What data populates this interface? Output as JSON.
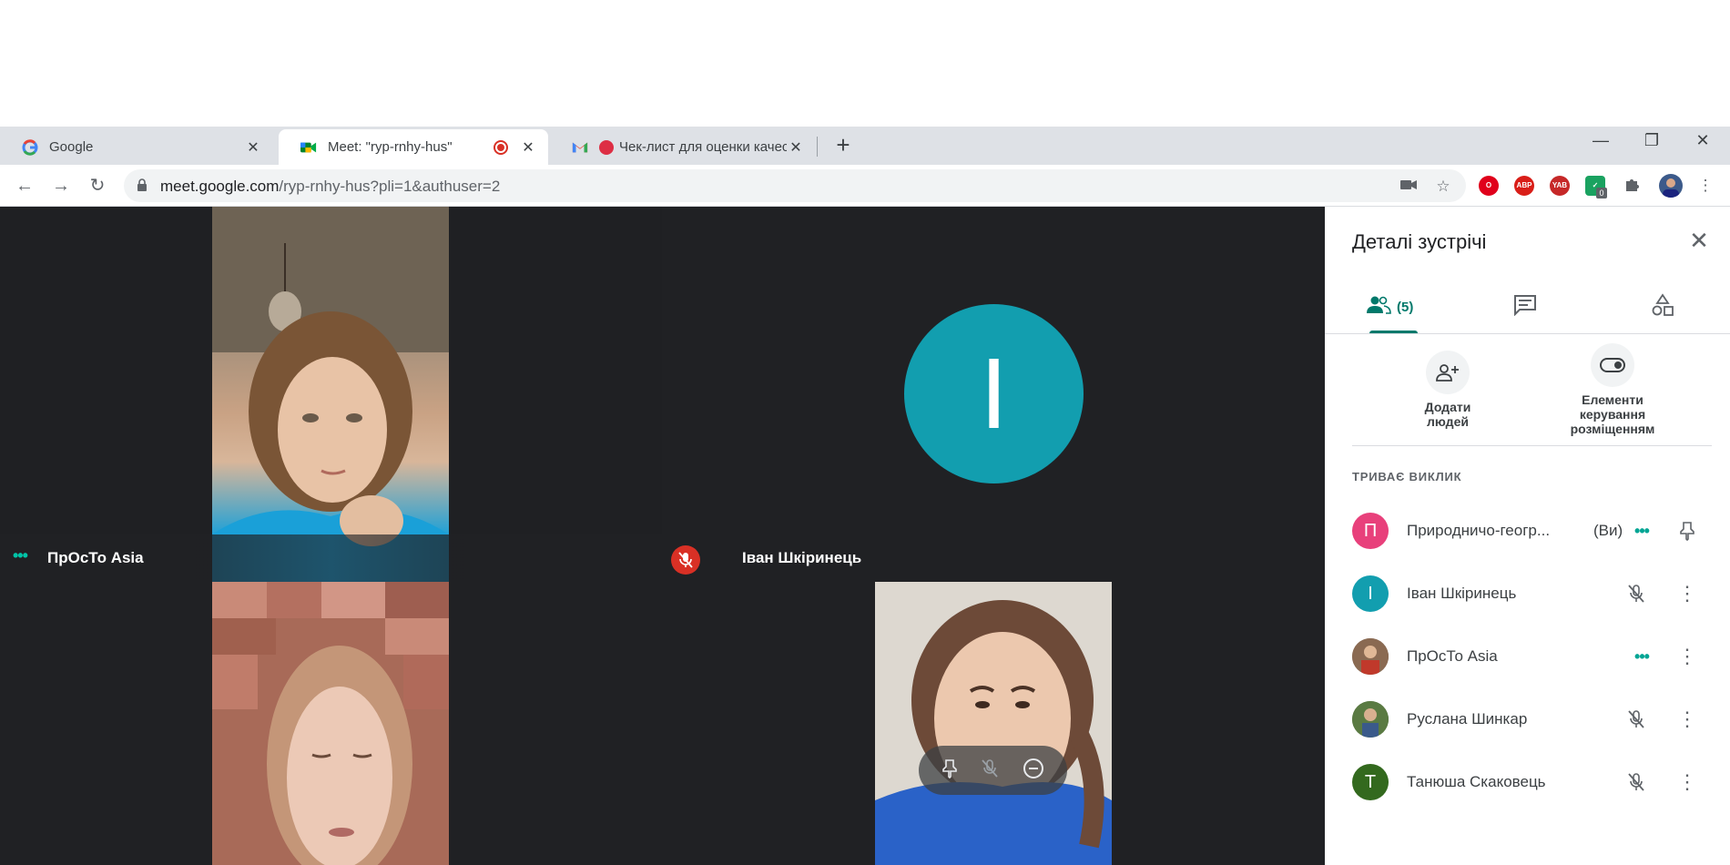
{
  "browser": {
    "tabs": [
      {
        "title": "Google",
        "icon": "google-icon"
      },
      {
        "title": "Meet: \"ryp-rnhy-hus\"",
        "icon": "meet-icon",
        "recording": true
      },
      {
        "title": "Чек-лист для оценки качест",
        "icon": "gmail-icon"
      }
    ],
    "url_host": "meet.google.com",
    "url_rest": "/ryp-rnhy-hus?pli=1&authuser=2",
    "extension_badges": {
      "abp": "ABP",
      "yab": "YAB",
      "count": "0"
    }
  },
  "meet": {
    "tiles": {
      "prosto_label": "ПрОсТо Asia",
      "ivan_label": "Іван Шкіринець",
      "ivan_initial": "I"
    }
  },
  "panel": {
    "title": "Деталі зустрічі",
    "people_count": "(5)",
    "add_people_label": "Додати людей",
    "host_controls_label": "Елементи керування розміщенням",
    "section_title": "ТРИВАЄ ВИКЛИК",
    "you_label": "(Ви)",
    "participants": [
      {
        "name": "Природничо-геогр...",
        "initial": "П",
        "color": "#e8407b",
        "status": "speaking",
        "you": true
      },
      {
        "name": "Іван Шкіринець",
        "initial": "I",
        "color": "#129eaf",
        "status": "muted"
      },
      {
        "name": "ПрОсТо Asia",
        "initial": "",
        "color": "#7a5a4a",
        "status": "speaking"
      },
      {
        "name": "Руслана Шинкар",
        "initial": "",
        "color": "#4a6a3a",
        "status": "muted"
      },
      {
        "name": "Танюша Скаковець",
        "initial": "Т",
        "color": "#33691e",
        "status": "muted"
      }
    ]
  }
}
